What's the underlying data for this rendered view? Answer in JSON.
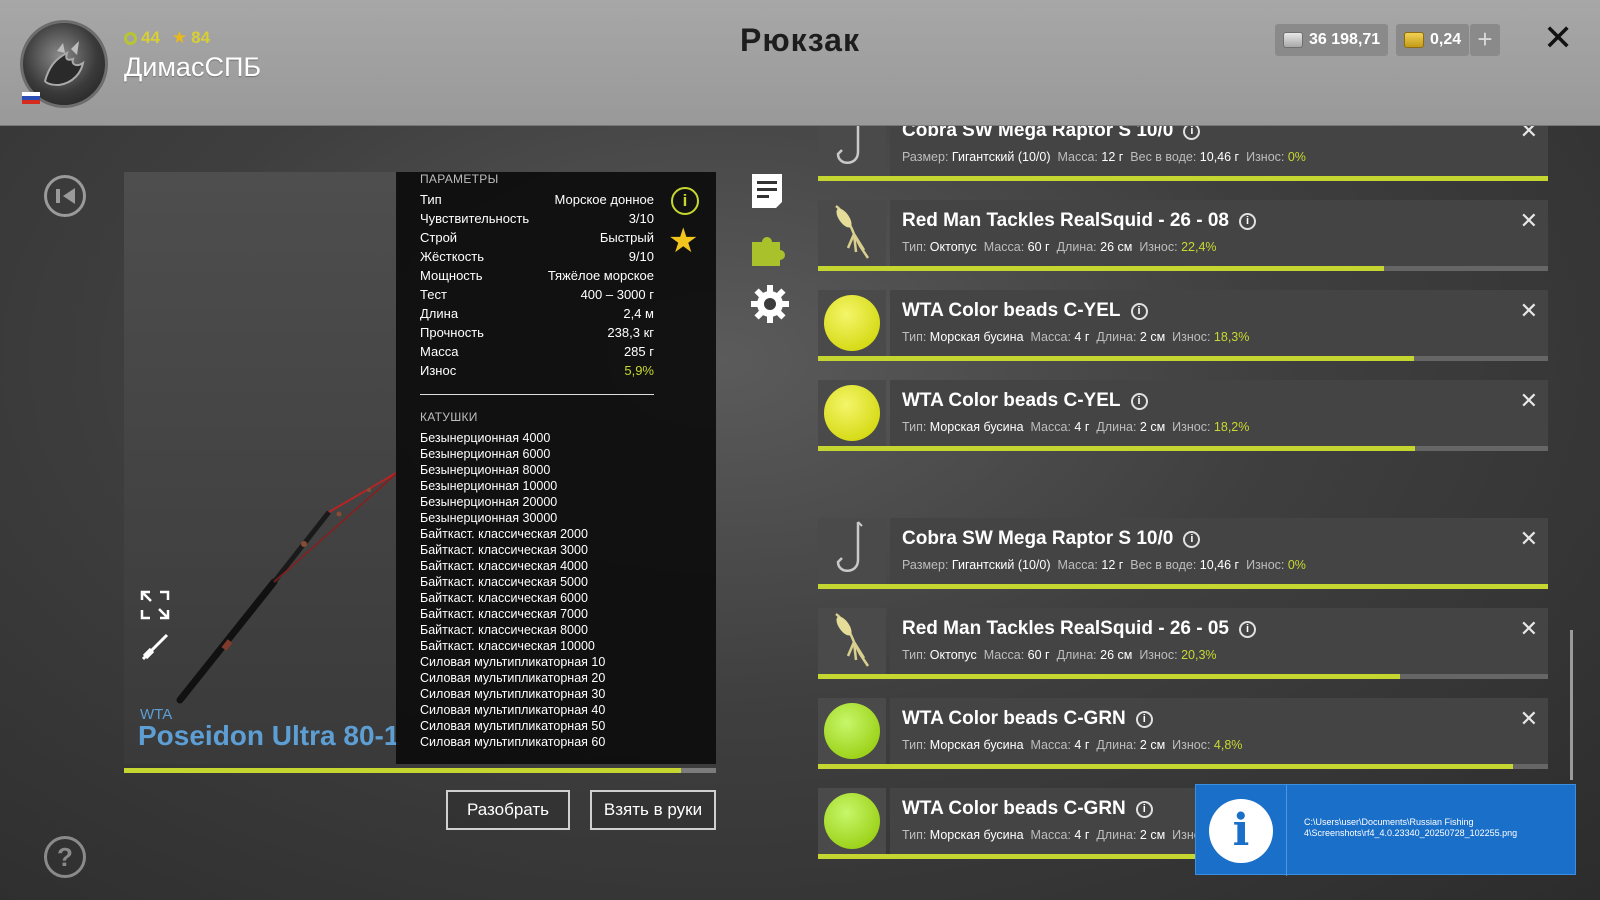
{
  "player": {
    "rank_level": "44",
    "star_level": "84",
    "nickname": "ДимасСПБ"
  },
  "page_title": "Рюкзак",
  "currency": {
    "silver": "36 198,71",
    "gold": "0,24"
  },
  "item_preview": {
    "brand": "WTA",
    "name": "Poseidon Ultra 80-1"
  },
  "params": {
    "section_title": "ПАРАМЕТРЫ",
    "rows": [
      {
        "label": "Тип",
        "value": "Морское донное"
      },
      {
        "label": "Чувствительность",
        "value": "3/10"
      },
      {
        "label": "Строй",
        "value": "Быстрый"
      },
      {
        "label": "Жёсткость",
        "value": "9/10"
      },
      {
        "label": "Мощность",
        "value": "Тяжёлое морское"
      },
      {
        "label": "Тест",
        "value": "400 – 3000 г"
      },
      {
        "label": "Длина",
        "value": "2,4 м"
      },
      {
        "label": "Прочность",
        "value": "238,3 кг"
      },
      {
        "label": "Масса",
        "value": "285 г"
      },
      {
        "label": "Износ",
        "value": "5,9%"
      }
    ],
    "reels_title": "КАТУШКИ",
    "reels": [
      "Безынерционная 4000",
      "Безынерционная 6000",
      "Безынерционная 8000",
      "Безынерционная 10000",
      "Безынерционная 20000",
      "Безынерционная 30000",
      "Байткаст. классическая 2000",
      "Байткаст. классическая 3000",
      "Байткаст. классическая 4000",
      "Байткаст. классическая 5000",
      "Байткаст. классическая 6000",
      "Байткаст. классическая 7000",
      "Байткаст. классическая 8000",
      "Байткаст. классическая 10000",
      "Силовая мультипликаторная 10",
      "Силовая мультипликаторная 20",
      "Силовая мультипликаторная 30",
      "Силовая мультипликаторная 40",
      "Силовая мультипликаторная 50",
      "Силовая мультипликаторная 60"
    ],
    "wear_fraction": 0.941
  },
  "buttons": {
    "disassemble": "Разобрать",
    "take_in_hands": "Взять в руки"
  },
  "colors": {
    "accent_green": "#c6d630",
    "rod_name_blue": "#5d9fd4",
    "toast_blue": "#1a6fc9"
  },
  "inventory": [
    {
      "icon": "hook-icon",
      "name": "Cobra SW Mega Raptor S 10/0",
      "k1": "Размер:",
      "v1": "Гигантский (10/0)",
      "k2": "Масса:",
      "v2": "12 г",
      "k3": "Вес в воде:",
      "v3": "10,46 г",
      "k4": "Износ:",
      "v4": "0%",
      "durability": 1.0
    },
    {
      "icon": "squid-lure-icon",
      "name": "Red Man Tackles RealSquid - 26 - 08",
      "k1": "Тип:",
      "v1": "Октопус",
      "k2": "Масса:",
      "v2": "60 г",
      "k3": "Длина:",
      "v3": "26 см",
      "k4": "Износ:",
      "v4": "22,4%",
      "durability": 0.776
    },
    {
      "icon": "bead-yellow-icon",
      "name": "WTA Color beads C-YEL",
      "k1": "Тип:",
      "v1": "Морская бусина",
      "k2": "Масса:",
      "v2": "4 г",
      "k3": "Длина:",
      "v3": "2 см",
      "k4": "Износ:",
      "v4": "18,3%",
      "durability": 0.817
    },
    {
      "icon": "bead-yellow-icon",
      "name": "WTA Color beads C-YEL",
      "k1": "Тип:",
      "v1": "Морская бусина",
      "k2": "Масса:",
      "v2": "4 г",
      "k3": "Длина:",
      "v3": "2 см",
      "k4": "Износ:",
      "v4": "18,2%",
      "durability": 0.818
    },
    {
      "icon": "hook-icon",
      "name": "Cobra SW Mega Raptor S 10/0",
      "k1": "Размер:",
      "v1": "Гигантский (10/0)",
      "k2": "Масса:",
      "v2": "12 г",
      "k3": "Вес в воде:",
      "v3": "10,46 г",
      "k4": "Износ:",
      "v4": "0%",
      "durability": 1.0
    },
    {
      "icon": "squid-lure-icon",
      "name": "Red Man Tackles RealSquid - 26 - 05",
      "k1": "Тип:",
      "v1": "Октопус",
      "k2": "Масса:",
      "v2": "60 г",
      "k3": "Длина:",
      "v3": "26 см",
      "k4": "Износ:",
      "v4": "20,3%",
      "durability": 0.797
    },
    {
      "icon": "bead-green-icon",
      "name": "WTA Color beads C-GRN",
      "k1": "Тип:",
      "v1": "Морская бусина",
      "k2": "Масса:",
      "v2": "4 г",
      "k3": "Длина:",
      "v3": "2 см",
      "k4": "Износ:",
      "v4": "4,8%",
      "durability": 0.952
    },
    {
      "icon": "bead-green-icon",
      "name": "WTA Color beads C-GRN",
      "k1": "Тип:",
      "v1": "Морская бусина",
      "k2": "Масса:",
      "v2": "4 г",
      "k3": "Длина:",
      "v3": "2 см",
      "k4": "Износ:",
      "v4": "",
      "durability": 0.85
    }
  ],
  "toast": {
    "path": "C:\\Users\\user\\Documents\\Russian Fishing 4\\Screenshots\\rf4_4.0.23340_20250728_102255.png"
  }
}
